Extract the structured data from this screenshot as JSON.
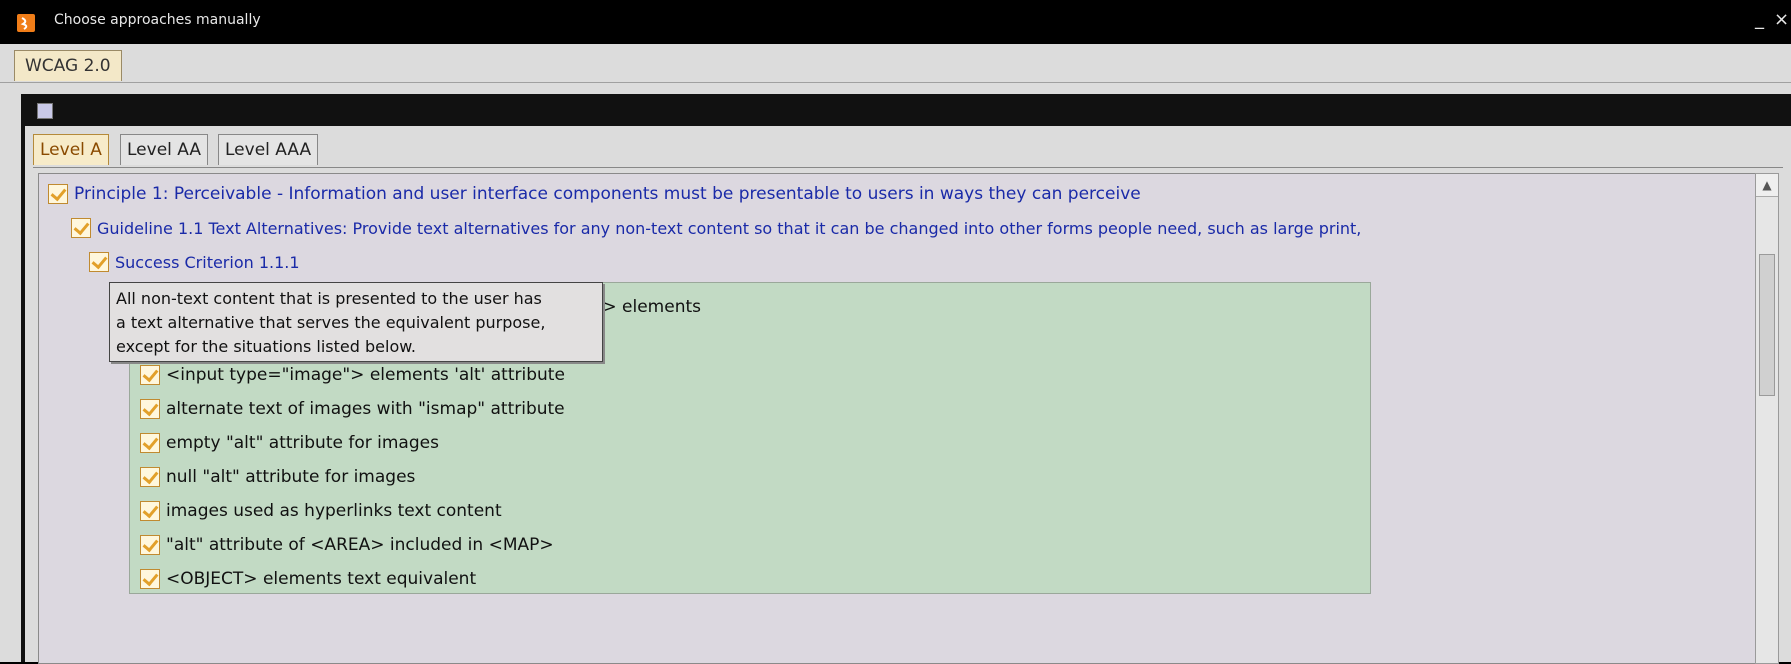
{
  "window": {
    "title": "Choose approaches manually",
    "minimize_glyph": "_",
    "close_glyph": "×",
    "app_icon": "java-app-icon"
  },
  "outer_tabs": [
    {
      "label": "WCAG 2.0",
      "active": true
    }
  ],
  "inner_frame": {
    "icon": "java-cup-icon"
  },
  "level_tabs": [
    {
      "label": "Level A",
      "active": true
    },
    {
      "label": "Level AA",
      "active": false
    },
    {
      "label": "Level AAA",
      "active": false
    }
  ],
  "tree": {
    "principle": {
      "label": "Principle 1: Perceivable - Information and user interface components must be presentable to users in ways they can perceive",
      "checked": true
    },
    "guideline": {
      "label": "Guideline 1.1 Text Alternatives: Provide text alternatives for any non-text content so that it can be changed into other forms people need, such as large print,",
      "checked": true
    },
    "criterion": {
      "label": "Success Criterion 1.1.1",
      "checked": true
    },
    "approaches": [
      {
        "label": "T> elements",
        "checked": true
      },
      {
        "label": "<input type=\"image\"> elements 'alt' attribute",
        "checked": true
      },
      {
        "label": "alternate text of images with \"ismap\" attribute",
        "checked": true
      },
      {
        "label": "empty \"alt\" attribute for images",
        "checked": true
      },
      {
        "label": "null \"alt\" attribute for images",
        "checked": true
      },
      {
        "label": "images used as hyperlinks text content",
        "checked": true
      },
      {
        "label": "\"alt\" attribute of <AREA> included in <MAP>",
        "checked": true
      },
      {
        "label": "<OBJECT> elements text equivalent",
        "checked": true
      }
    ]
  },
  "tooltip": {
    "lines": [
      "All non-text content that is presented to the user has",
      "a text alternative that serves the equivalent purpose,",
      "except for the situations listed below."
    ]
  },
  "colors": {
    "tree_text": "#1a2aa8",
    "approach_panel_bg": "#c2dac4",
    "checkbox_mark": "#e2a02a"
  }
}
